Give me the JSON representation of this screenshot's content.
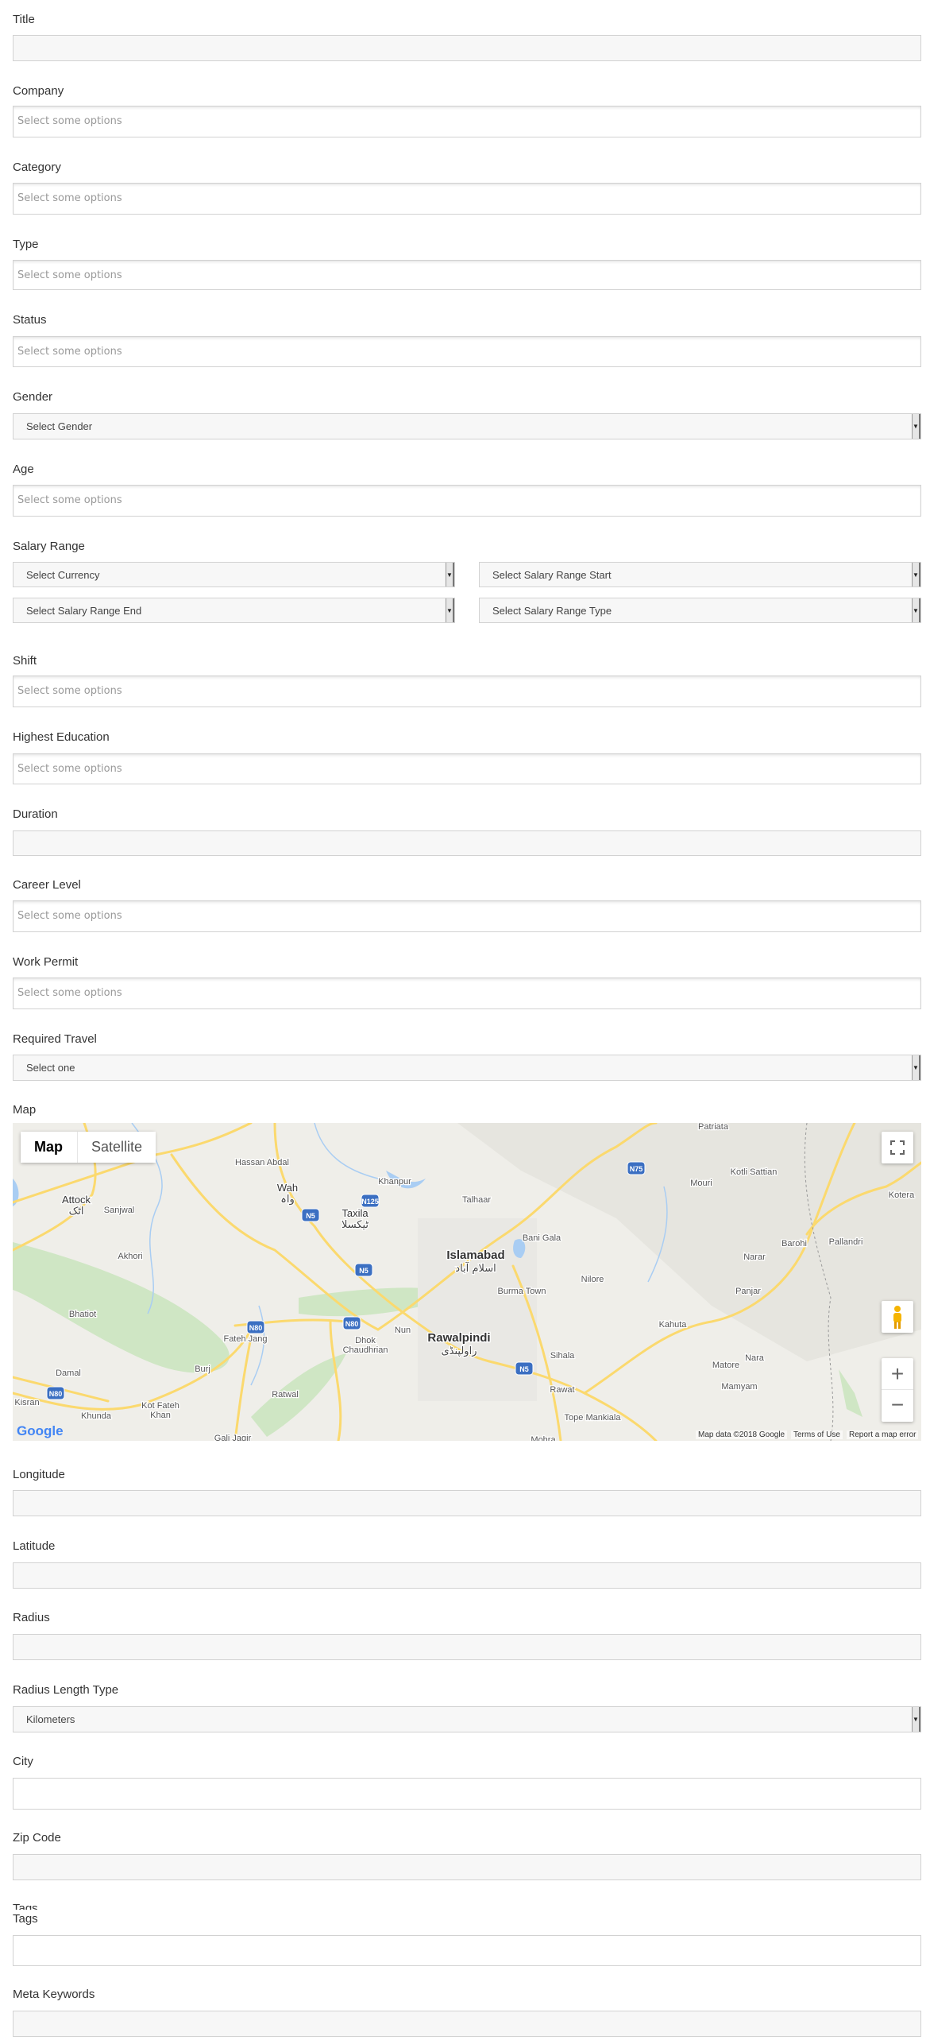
{
  "fields": [
    {
      "label": "Title",
      "kind": "text"
    },
    {
      "label": "Company",
      "kind": "chosen",
      "placeholder": "Select some options"
    },
    {
      "label": "Category",
      "kind": "chosen",
      "placeholder": "Select some options"
    },
    {
      "label": "Type",
      "kind": "chosen",
      "placeholder": "Select some options"
    },
    {
      "label": "Status",
      "kind": "chosen",
      "placeholder": "Select some options"
    },
    {
      "label": "Gender",
      "kind": "select",
      "value": "Select Gender"
    },
    {
      "label": "Age",
      "kind": "chosen",
      "placeholder": "Select some options"
    },
    {
      "label": "Salary Range",
      "kind": "salary",
      "selects": [
        "Select Currency",
        "Select Salary Range Start",
        "Select Salary Range End",
        "Select Salary Range Type"
      ]
    },
    {
      "label": "Shift",
      "kind": "chosen",
      "placeholder": "Select some options"
    },
    {
      "label": "Highest Education",
      "kind": "chosen",
      "placeholder": "Select some options"
    },
    {
      "label": "Duration",
      "kind": "text"
    },
    {
      "label": "Career Level",
      "kind": "chosen",
      "placeholder": "Select some options"
    },
    {
      "label": "Work Permit",
      "kind": "chosen",
      "placeholder": "Select some options"
    },
    {
      "label": "Required Travel",
      "kind": "select",
      "value": "Select one"
    },
    {
      "label": "Map",
      "kind": "map"
    },
    {
      "label": "Longitude",
      "kind": "text"
    },
    {
      "label": "Latitude",
      "kind": "text"
    },
    {
      "label": "Radius",
      "kind": "text"
    },
    {
      "label": "Radius Length Type",
      "kind": "select",
      "value": "Kilometers"
    },
    {
      "label": "City",
      "kind": "white"
    },
    {
      "label": "Zip Code",
      "kind": "text"
    },
    {
      "label": "Tags",
      "kind": "tags",
      "duplicate_label": "Tags"
    },
    {
      "label": "Meta Keywords",
      "kind": "text"
    }
  ],
  "map": {
    "type_buttons": [
      "Map",
      "Satellite"
    ],
    "active_type": "Map",
    "footer": [
      "Map data ©2018 Google",
      "Terms of Use",
      "Report a map error"
    ],
    "logo": "Google",
    "zoom_in": "+",
    "zoom_out": "−",
    "icons": {
      "fullscreen": "fullscreen-icon",
      "pegman": "street-view-pegman-icon"
    },
    "colors": {
      "land": "#efeee9",
      "road": "#fbd96e",
      "water": "#a9cdf3",
      "park": "#cfe6c4",
      "shield": "#3b6fc2"
    },
    "places": [
      "Hassan Abdal",
      "Wah",
      "Attock",
      "Sanjwal",
      "Khanpur",
      "Taxila",
      "Talhaar",
      "Islamabad",
      "Bani Gala",
      "Akhori",
      "Burma Town",
      "Nilore",
      "Bhatiot",
      "Fateh Jang",
      "Dhok",
      "Chaudhrian",
      "Nun",
      "Rawalpindi",
      "Sihala",
      "Kahuta",
      "Panjar",
      "Narar",
      "Barohi",
      "Pallandri",
      "Kotli Sattian",
      "Mouri",
      "Patriata",
      "Kotera",
      "Burj",
      "Damal",
      "Kisran",
      "Khunda",
      "Kot Fateh",
      "Khan",
      "Ratwal",
      "Gali Jagir",
      "Matore",
      "Nara",
      "Mamyam",
      "Rawat",
      "Tope Mankiala",
      "Mohra"
    ],
    "urdu_places": [
      "اسلام آباد",
      "راولپنڈی",
      "واہ",
      "ٹیکسلا",
      "اٹک"
    ],
    "shields": [
      "N75",
      "N125",
      "N5",
      "N5",
      "N80",
      "N80",
      "N5",
      "N80"
    ]
  }
}
